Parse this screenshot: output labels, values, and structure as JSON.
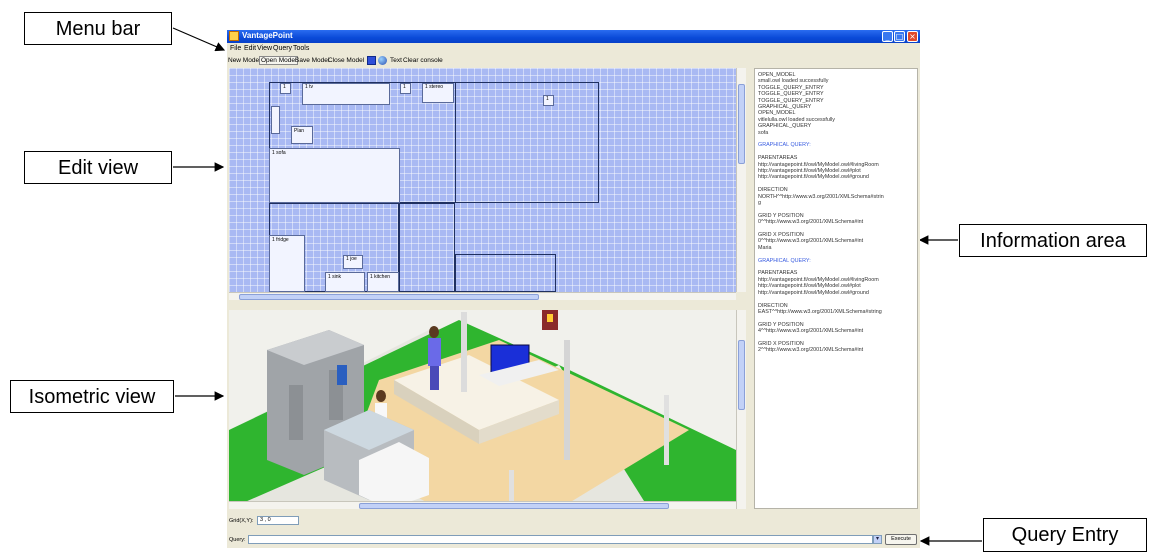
{
  "callouts": {
    "menu_bar": "Menu bar",
    "edit_view": "Edit view",
    "isometric_view": "Isometric view",
    "information_area": "Information area",
    "query_entry": "Query Entry"
  },
  "window": {
    "title": "VantagePoint",
    "menu": [
      "File",
      "Edit",
      "View",
      "Query",
      "Tools"
    ],
    "toolbar": {
      "new_model": "New Model",
      "open_model": "Open Model",
      "save_model": "Save Model",
      "close_model": "Close Model",
      "text": "Text",
      "clear_console": "Clear console"
    }
  },
  "edit_view": {
    "labels": {
      "tv": "1  tv",
      "stereo": "1  stereo",
      "sofa": "1  sofa",
      "fridge": "1  fridge",
      "plant": "Plan",
      "joe": "1  joe",
      "sink": "1  sink",
      "kitchen": "1  kitchen",
      "small1": "1",
      "small2": "1",
      "small3": "1"
    }
  },
  "info": {
    "lines": [
      {
        "t": "OPEN_MODEL"
      },
      {
        "t": "small.owl loaded successfully"
      },
      {
        "t": "TOGGLE_QUERY_ENTRY"
      },
      {
        "t": "TOGGLE_QUERY_ENTRY"
      },
      {
        "t": "TOGGLE_QUERY_ENTRY"
      },
      {
        "t": "GRAPHICAL_QUERY"
      },
      {
        "t": "OPEN_MODEL"
      },
      {
        "t": "vitlelulla.owl loaded successfully"
      },
      {
        "t": "GRAPHICAL_QUERY"
      },
      {
        "t": "sofa"
      },
      {
        "t": ""
      },
      {
        "t": "GRAPHICAL QUERY:",
        "blue": true
      },
      {
        "t": ""
      },
      {
        "t": "PARENTAREAS"
      },
      {
        "t": "http://vantagepoint.fi/owl/MyModel.owl#livingRoom"
      },
      {
        "t": "http://vantagepoint.fi/owl/MyModel.owl#plot"
      },
      {
        "t": "http://vantagepoint.fi/owl/MyModel.owl#ground"
      },
      {
        "t": ""
      },
      {
        "t": "DIRECTION"
      },
      {
        "t": "NORTH^^http://www.w3.org/2001/XMLSchema#strin"
      },
      {
        "t": "g"
      },
      {
        "t": ""
      },
      {
        "t": "GRID Y POSITION"
      },
      {
        "t": "0^^http://www.w3.org/2001/XMLSchema#int"
      },
      {
        "t": ""
      },
      {
        "t": "GRID X POSITION"
      },
      {
        "t": "0^^http://www.w3.org/2001/XMLSchema#int"
      },
      {
        "t": "Maria"
      },
      {
        "t": ""
      },
      {
        "t": "GRAPHICAL QUERY:",
        "blue": true
      },
      {
        "t": ""
      },
      {
        "t": "PARENTAREAS"
      },
      {
        "t": "http://vantagepoint.fi/owl/MyModel.owl#livingRoom"
      },
      {
        "t": "http://vantagepoint.fi/owl/MyModel.owl#plot"
      },
      {
        "t": "http://vantagepoint.fi/owl/MyModel.owl#ground"
      },
      {
        "t": ""
      },
      {
        "t": "DIRECTION"
      },
      {
        "t": "EAST^^http://www.w3.org/2001/XMLSchema#string"
      },
      {
        "t": ""
      },
      {
        "t": "GRID Y POSITION"
      },
      {
        "t": "4^^http://www.w3.org/2001/XMLSchema#int"
      },
      {
        "t": ""
      },
      {
        "t": "GRID X POSITION"
      },
      {
        "t": "2^^http://www.w3.org/2001/XMLSchema#int"
      }
    ]
  },
  "bottom": {
    "grid_label": "Grid(X,Y):",
    "grid_value": "3 , 0",
    "query_label": "Query:",
    "query_value": "",
    "dropdown_icon": "chevron-down-icon",
    "execute_label": "Execute"
  },
  "colors": {
    "edit_bg": "#a9b9f3",
    "floor": "#f3d7a3",
    "grass": "#2fb52f",
    "info_blue": "#3a5de0",
    "titlebar": "#0a4ad8"
  }
}
